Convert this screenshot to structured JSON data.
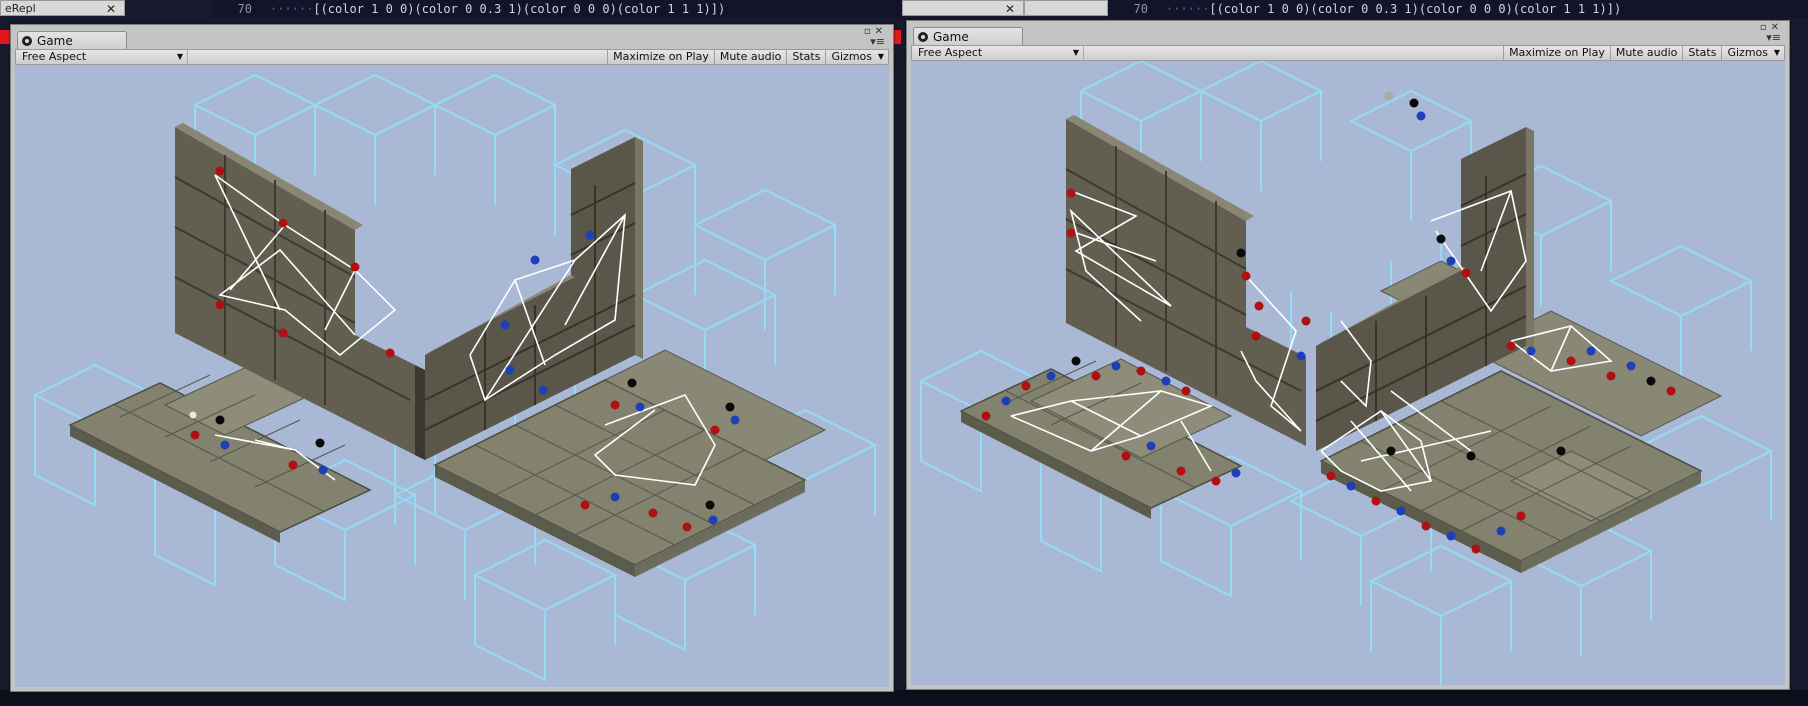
{
  "background": {
    "left_editor": {
      "line_number": "70",
      "code": "[(color 1 0 0)(color 0 0.3 1)(color 0 0 0)(color 1 1 1)])",
      "title_fragment": "eRepl"
    },
    "right_editor": {
      "line_number": "70",
      "code": "[(color 1 0 0)(color 0 0.3 1)(color 0 0 0)(color 1 1 1)])"
    }
  },
  "windows": [
    {
      "tab_label": "Game",
      "aspect_label": "Free Aspect",
      "buttons": {
        "maximize": "Maximize on Play",
        "mute": "Mute audio",
        "stats": "Stats",
        "gizmos": "Gizmos"
      }
    },
    {
      "tab_label": "Game",
      "aspect_label": "Free Aspect",
      "buttons": {
        "maximize": "Maximize on Play",
        "mute": "Mute audio",
        "stats": "Stats",
        "gizmos": "Gizmos"
      }
    }
  ],
  "scene_colors": {
    "sky": "#a9b9d5",
    "stone": "#8a8a78",
    "wall": "#5a564a",
    "wireframe": "#8fe4ff",
    "dot_red": "#b01010",
    "dot_blue": "#1f3fb8",
    "dot_black": "#0a0a0a",
    "dot_white": "#e8e8e8",
    "lines": "#ffffff"
  }
}
